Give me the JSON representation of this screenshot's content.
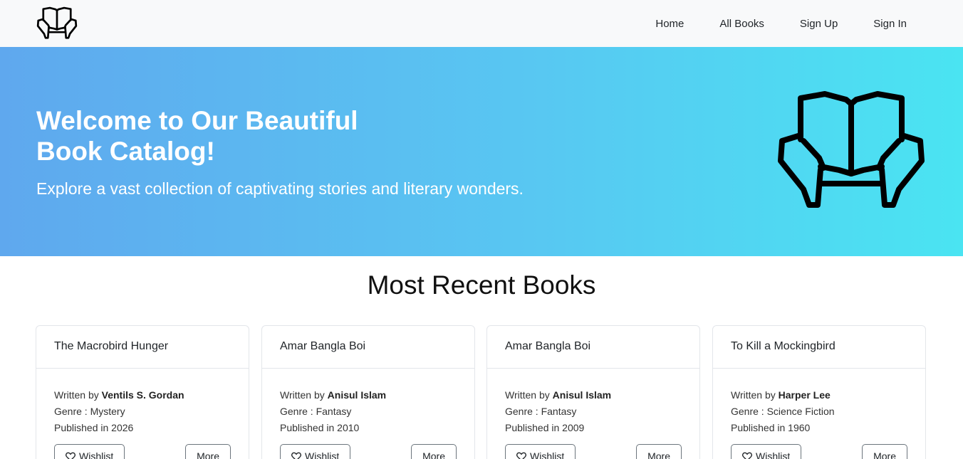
{
  "nav": {
    "logo_icon": "open-book-hands-icon",
    "links": [
      "Home",
      "All Books",
      "Sign Up",
      "Sign In"
    ]
  },
  "hero": {
    "title_line1": "Welcome to Our Beautiful",
    "title_line2": "Book Catalog!",
    "subtitle": "Explore a vast collection of captivating stories and literary wonders.",
    "icon": "open-book-hands-icon",
    "gradient": [
      "#5fa8ee",
      "#4ae4f2"
    ]
  },
  "section": {
    "title": "Most Recent Books"
  },
  "books": [
    {
      "title": "The Macrobird Hunger",
      "written_by_label": "Written by",
      "author": "Ventils S. Gordan",
      "genre": "Genre : Mystery",
      "published": "Published in 2026",
      "wishlist": "Wishlist",
      "more": "More"
    },
    {
      "title": "Amar Bangla Boi",
      "written_by_label": "Written by",
      "author": "Anisul Islam",
      "genre": "Genre : Fantasy",
      "published": "Published in 2010",
      "wishlist": "Wishlist",
      "more": "More"
    },
    {
      "title": "Amar Bangla Boi",
      "written_by_label": "Written by",
      "author": "Anisul Islam",
      "genre": "Genre : Fantasy",
      "published": "Published in 2009",
      "wishlist": "Wishlist",
      "more": "More"
    },
    {
      "title": "To Kill a Mockingbird",
      "written_by_label": "Written by",
      "author": "Harper Lee",
      "genre": "Genre : Science Fiction",
      "published": "Published in 1960",
      "wishlist": "Wishlist",
      "more": "More"
    }
  ]
}
